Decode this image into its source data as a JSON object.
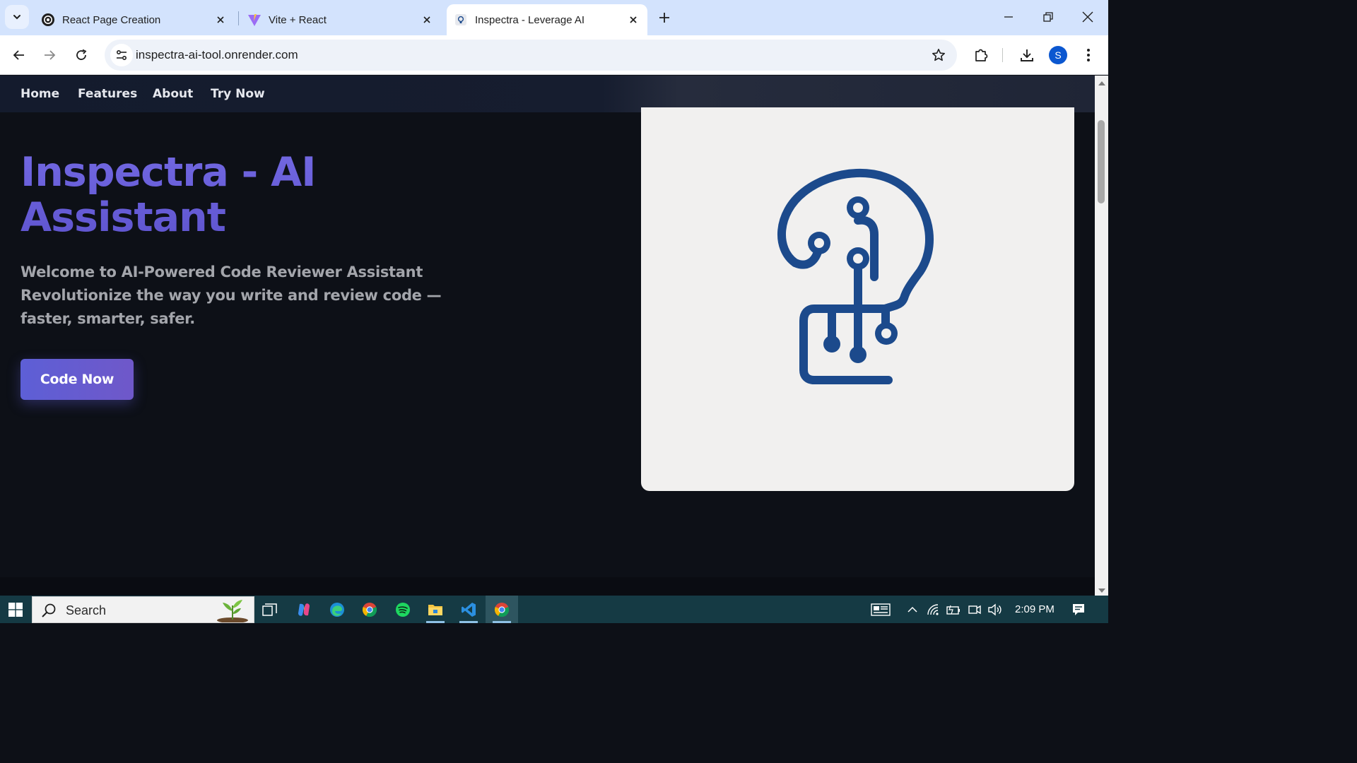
{
  "browser": {
    "tabs": [
      {
        "title": "React Page Creation",
        "favicon": "openai-icon",
        "active": false
      },
      {
        "title": "Vite + React",
        "favicon": "vite-icon",
        "active": false
      },
      {
        "title": "Inspectra - Leverage AI",
        "favicon": "bulb-icon",
        "active": true
      }
    ],
    "url": "inspectra-ai-tool.onrender.com",
    "profile_initial": "S"
  },
  "site": {
    "nav": [
      "Home",
      "Features",
      "About",
      "Try Now"
    ],
    "hero": {
      "title_line1": "Inspectra - AI",
      "title_line2": "Assistant",
      "subtitle_line1": "Welcome to AI-Powered Code Reviewer Assistant",
      "subtitle_line2": "Revolutionize the way you write and review code —",
      "subtitle_line3": "faster, smarter, safer.",
      "cta_label": "Code Now"
    },
    "colors": {
      "title": "#6d62dc",
      "cta_start": "#5d5fd6",
      "cta_end": "#6f58c9",
      "logo": "#1c4a8c",
      "background": "#0d1017"
    }
  },
  "taskbar": {
    "search_placeholder": "Search",
    "apps": [
      "task-view-icon",
      "copilot-icon",
      "edge-icon",
      "chrome-icon",
      "spotify-icon",
      "file-explorer-icon",
      "vscode-icon",
      "chrome-icon"
    ],
    "time": "2:09 PM"
  }
}
